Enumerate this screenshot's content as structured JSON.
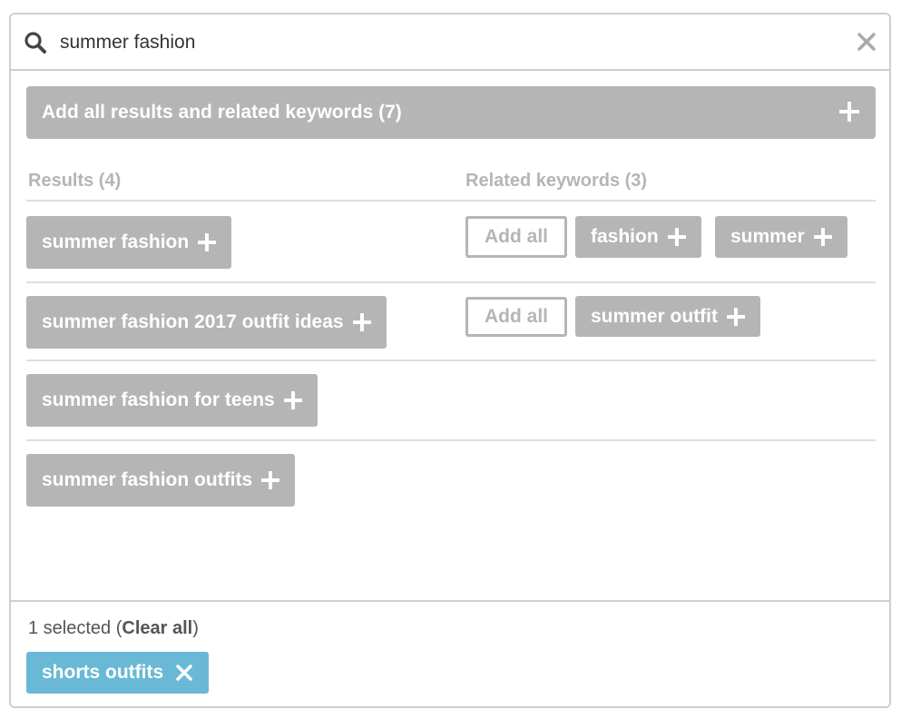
{
  "search": {
    "value": "summer fashion"
  },
  "add_all_bar": {
    "label": "Add all results and related keywords (7)"
  },
  "results": {
    "header": "Results (4)",
    "items": [
      {
        "label": "summer fashion"
      },
      {
        "label": "summer fashion 2017 outfit ideas"
      },
      {
        "label": "summer fashion for teens"
      },
      {
        "label": "summer fashion outfits"
      }
    ]
  },
  "related": {
    "header": "Related keywords (3)",
    "add_all_label": "Add all",
    "rows": [
      {
        "keywords": [
          {
            "label": "fashion"
          },
          {
            "label": "summer"
          }
        ]
      },
      {
        "keywords": [
          {
            "label": "summer outfit"
          }
        ]
      }
    ]
  },
  "footer": {
    "selected_prefix": "1 selected (",
    "clear_all": "Clear all",
    "selected_suffix": ")",
    "selected_items": [
      {
        "label": "shorts outfits"
      }
    ]
  },
  "colors": {
    "chip_gray": "#b5b5b5",
    "selected_blue": "#69b9d6",
    "border": "#cfcfcf"
  },
  "icons": [
    "search-icon",
    "close-icon",
    "plus-icon",
    "x-icon"
  ]
}
